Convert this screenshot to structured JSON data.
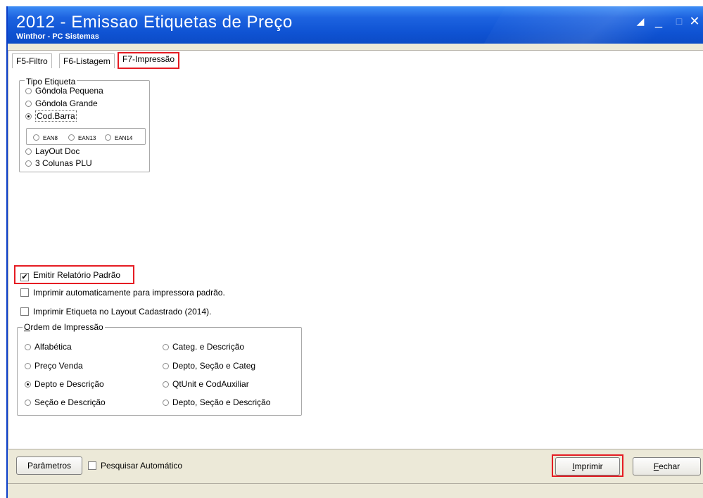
{
  "window": {
    "title": "2012 - Emissao Etiquetas de Preço",
    "subtitle": "Winthor - PC Sistemas"
  },
  "tabs": [
    {
      "label": "F5-Filtro"
    },
    {
      "label": "F6-Listagem"
    },
    {
      "label": "F7-Impressão",
      "selected": true
    }
  ],
  "tipo_etiqueta": {
    "title": "Tipo Etiqueta",
    "options": [
      "Gôndola Pequena",
      "Gôndola Grande",
      "Cod.Barra",
      "LayOut Doc",
      "3 Colunas PLU"
    ],
    "selected": "Cod.Barra",
    "ean_options": [
      "EAN8",
      "EAN13",
      "EAN14"
    ]
  },
  "checkboxes": [
    {
      "label": "Emitir Relatório Padrão",
      "checked": true
    },
    {
      "label": "Imprimir automaticamente para impressora padrão.",
      "checked": false
    },
    {
      "label": "Imprimir Etiqueta no Layout Cadastrado (2014).",
      "checked": false
    }
  ],
  "ordem_impressao": {
    "title": "Ordem de Impressão",
    "left": [
      "Alfabética",
      "Preço Venda",
      "Depto e Descrição",
      "Seção e Descrição"
    ],
    "right": [
      "Categ. e Descrição",
      "Depto, Seção e Categ",
      "QtUnit e CodAuxiliar",
      "Depto, Seção e Descrição"
    ],
    "selected": "Depto e Descrição"
  },
  "footer": {
    "parametros_label": "Parâmetros",
    "pesquisar_label": "Pesquisar Automático",
    "pesquisar_checked": false,
    "imprimir_label": "Imprimir",
    "fechar_label": "Fechar"
  },
  "colors": {
    "titlebar": "#0f53d3",
    "highlight": "#e51c23",
    "face": "#ece9d8"
  },
  "icons": [
    "restore-icon",
    "minimize-icon",
    "maximize-icon",
    "close-icon"
  ]
}
